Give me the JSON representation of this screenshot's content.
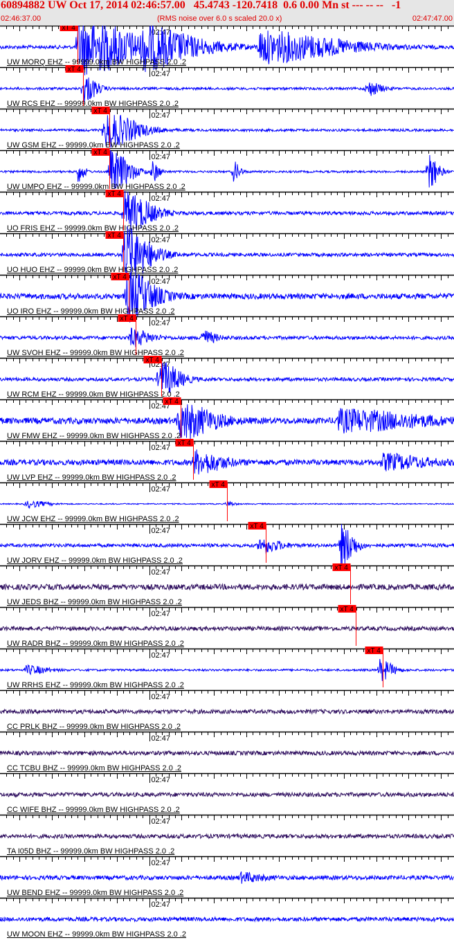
{
  "header": {
    "title": "60894882 UW Oct 17, 2014 02:46:57.00   45.4743 -120.7418  0.6 0.00 Mn st --- -- --   -1",
    "start_time": "02:46:37.00",
    "end_time": "02:47:47.00",
    "note": "(RMS noise over 6.0 s scaled 20.0 x)"
  },
  "chart_data": {
    "type": "line",
    "title": "Seismogram record section",
    "x_unit": "seconds after 02:46:37.00",
    "xlim": [
      0,
      70
    ],
    "minute_tick_label": "02:47",
    "minute_tick_time": 23,
    "pick_label": "xT 4",
    "colors": {
      "blue": "#0000ff",
      "purple": "#301060",
      "pick": "#ff0000",
      "header_text": "#e00000"
    },
    "traces": [
      {
        "label": "UW MORQ EHZ -- 99999.0km BW  HIGHPASS  2.0 .2",
        "pick": 11.95,
        "color": "blue",
        "noise": 2.5,
        "events": [
          [
            12,
            40,
            9
          ],
          [
            22,
            22,
            9
          ],
          [
            40,
            22,
            12
          ]
        ]
      },
      {
        "label": "UW RCS EHZ -- 99999.0km BW  HIGHPASS  2.0 .2",
        "pick": 12.8,
        "color": "blue",
        "noise": 1.8,
        "events": [
          [
            12.8,
            20,
            2
          ],
          [
            56.6,
            10,
            2
          ]
        ]
      },
      {
        "label": "UW GSM EHZ -- 99999.0km BW  HIGHPASS  2.0 .2",
        "pick": 16.9,
        "color": "blue",
        "noise": 1.8,
        "events": [
          [
            16,
            25,
            5
          ]
        ]
      },
      {
        "label": "UW UMPQ EHZ -- 99999.0km BW  HIGHPASS  2.0 .2",
        "pick": 16.9,
        "color": "blue",
        "noise": 1.5,
        "events": [
          [
            12,
            14,
            1
          ],
          [
            17,
            30,
            3
          ],
          [
            23.5,
            14,
            1
          ],
          [
            36,
            14,
            1
          ],
          [
            66,
            25,
            1.5
          ]
        ]
      },
      {
        "label": "UO FRIS EHZ -- 99999.0km BW  HIGHPASS  2.0 .2",
        "pick": 19.0,
        "color": "blue",
        "noise": 2.5,
        "events": [
          [
            19,
            30,
            4
          ]
        ]
      },
      {
        "label": "UO HUO EHZ -- 99999.0km BW  HIGHPASS  2.0 .2",
        "pick": 19.0,
        "color": "blue",
        "noise": 2.5,
        "events": [
          [
            19,
            40,
            4
          ]
        ]
      },
      {
        "label": "UO IRO EHZ -- 99999.0km BW  HIGHPASS  2.0 .2",
        "pick": 19.85,
        "color": "blue",
        "noise": 4,
        "events": [
          [
            19.5,
            35,
            4
          ]
        ]
      },
      {
        "label": "UW SVOH EHZ -- 99999.0km BW  HIGHPASS  2.0 .2",
        "pick": 20.9,
        "color": "blue",
        "noise": 2.5,
        "events": [
          [
            20,
            12,
            3
          ],
          [
            31,
            10,
            2
          ]
        ]
      },
      {
        "label": "UW RCM EHZ -- 99999.0km BW  HIGHPASS  2.0 .2",
        "pick": 24.9,
        "color": "blue",
        "noise": 2.5,
        "events": [
          [
            24.5,
            25,
            3
          ]
        ]
      },
      {
        "label": "UW FMW EHZ -- 99999.0km BW  HIGHPASS  2.0 .2",
        "pick": 27.85,
        "color": "blue",
        "noise": 4.5,
        "events": [
          [
            27.5,
            25,
            5
          ],
          [
            52,
            14,
            12
          ]
        ]
      },
      {
        "label": "UW LVP EHZ -- 99999.0km BW  HIGHPASS  2.0 .2",
        "pick": 29.8,
        "color": "blue",
        "noise": 4,
        "events": [
          [
            30,
            15,
            4
          ],
          [
            59,
            10,
            6
          ]
        ]
      },
      {
        "label": "UW JCW EHZ -- 99999.0km BW  HIGHPASS  2.0 .2",
        "pick": 35.0,
        "color": "blue",
        "noise": 0.8,
        "events": [
          [
            4,
            5,
            3
          ],
          [
            35,
            4,
            1
          ]
        ]
      },
      {
        "label": "UW JORV EHZ -- 99999.0km BW  HIGHPASS  2.0 .2",
        "pick": 41.0,
        "color": "blue",
        "noise": 2.5,
        "events": [
          [
            40,
            10,
            3
          ],
          [
            52.5,
            30,
            2
          ]
        ]
      },
      {
        "label": "UW JEDS BHZ -- 99999.0km BW  HIGHPASS  2.0 .2",
        "pick": 54.0,
        "color": "purple",
        "noise": 4,
        "events": []
      },
      {
        "label": "UW RADR BHZ -- 99999.0km BW  HIGHPASS  2.0 .2",
        "pick": 54.85,
        "color": "purple",
        "noise": 3,
        "events": []
      },
      {
        "label": "UW RRHS EHZ -- 99999.0km BW  HIGHPASS  2.0 .2",
        "pick": 59.0,
        "color": "blue",
        "noise": 1.5,
        "events": [
          [
            4,
            6,
            3
          ],
          [
            58.5,
            15,
            2
          ]
        ]
      },
      {
        "label": "CC PRLK BHZ -- 99999.0km BW  HIGHPASS  2.0 .2",
        "pick": null,
        "color": "purple",
        "noise": 3,
        "events": []
      },
      {
        "label": "CC TCBU BHZ -- 99999.0km BW  HIGHPASS  2.0 .2",
        "pick": null,
        "color": "purple",
        "noise": 3,
        "events": []
      },
      {
        "label": "CC WIFE BHZ -- 99999.0km BW  HIGHPASS  2.0 .2",
        "pick": null,
        "color": "purple",
        "noise": 3,
        "events": []
      },
      {
        "label": "TA I05D BHZ -- 99999.0km BW  HIGHPASS  2.0 .2",
        "pick": null,
        "color": "purple",
        "noise": 3,
        "events": []
      },
      {
        "label": "UW BEND EHZ -- 99999.0km BW  HIGHPASS  2.0 .2",
        "pick": null,
        "color": "blue",
        "noise": 3,
        "events": [
          [
            37,
            6,
            3
          ]
        ]
      },
      {
        "label": "UW MOON EHZ -- 99999.0km BW  HIGHPASS  2.0 .2",
        "pick": null,
        "color": "blue",
        "noise": 3,
        "events": []
      }
    ]
  }
}
